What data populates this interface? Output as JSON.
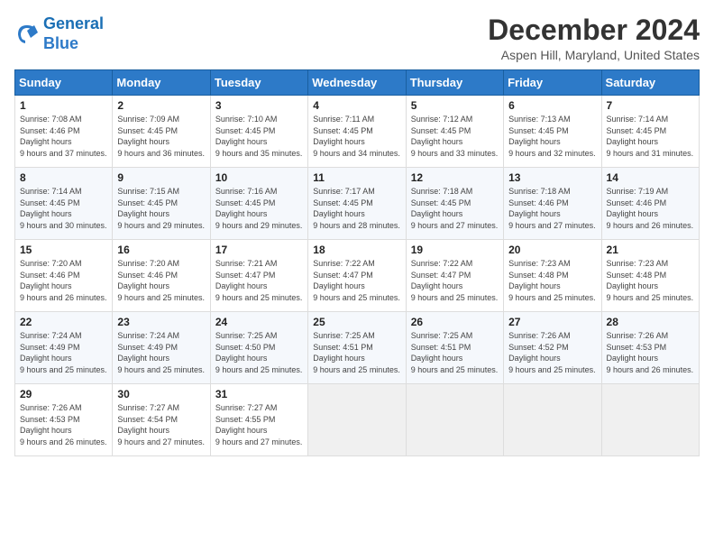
{
  "header": {
    "logo": {
      "line1": "General",
      "line2": "Blue"
    },
    "title": "December 2024",
    "subtitle": "Aspen Hill, Maryland, United States"
  },
  "weekdays": [
    "Sunday",
    "Monday",
    "Tuesday",
    "Wednesday",
    "Thursday",
    "Friday",
    "Saturday"
  ],
  "weeks": [
    [
      {
        "day": "1",
        "sunrise": "7:08 AM",
        "sunset": "4:46 PM",
        "daylight": "9 hours and 37 minutes."
      },
      {
        "day": "2",
        "sunrise": "7:09 AM",
        "sunset": "4:45 PM",
        "daylight": "9 hours and 36 minutes."
      },
      {
        "day": "3",
        "sunrise": "7:10 AM",
        "sunset": "4:45 PM",
        "daylight": "9 hours and 35 minutes."
      },
      {
        "day": "4",
        "sunrise": "7:11 AM",
        "sunset": "4:45 PM",
        "daylight": "9 hours and 34 minutes."
      },
      {
        "day": "5",
        "sunrise": "7:12 AM",
        "sunset": "4:45 PM",
        "daylight": "9 hours and 33 minutes."
      },
      {
        "day": "6",
        "sunrise": "7:13 AM",
        "sunset": "4:45 PM",
        "daylight": "9 hours and 32 minutes."
      },
      {
        "day": "7",
        "sunrise": "7:14 AM",
        "sunset": "4:45 PM",
        "daylight": "9 hours and 31 minutes."
      }
    ],
    [
      {
        "day": "8",
        "sunrise": "7:14 AM",
        "sunset": "4:45 PM",
        "daylight": "9 hours and 30 minutes."
      },
      {
        "day": "9",
        "sunrise": "7:15 AM",
        "sunset": "4:45 PM",
        "daylight": "9 hours and 29 minutes."
      },
      {
        "day": "10",
        "sunrise": "7:16 AM",
        "sunset": "4:45 PM",
        "daylight": "9 hours and 29 minutes."
      },
      {
        "day": "11",
        "sunrise": "7:17 AM",
        "sunset": "4:45 PM",
        "daylight": "9 hours and 28 minutes."
      },
      {
        "day": "12",
        "sunrise": "7:18 AM",
        "sunset": "4:45 PM",
        "daylight": "9 hours and 27 minutes."
      },
      {
        "day": "13",
        "sunrise": "7:18 AM",
        "sunset": "4:46 PM",
        "daylight": "9 hours and 27 minutes."
      },
      {
        "day": "14",
        "sunrise": "7:19 AM",
        "sunset": "4:46 PM",
        "daylight": "9 hours and 26 minutes."
      }
    ],
    [
      {
        "day": "15",
        "sunrise": "7:20 AM",
        "sunset": "4:46 PM",
        "daylight": "9 hours and 26 minutes."
      },
      {
        "day": "16",
        "sunrise": "7:20 AM",
        "sunset": "4:46 PM",
        "daylight": "9 hours and 25 minutes."
      },
      {
        "day": "17",
        "sunrise": "7:21 AM",
        "sunset": "4:47 PM",
        "daylight": "9 hours and 25 minutes."
      },
      {
        "day": "18",
        "sunrise": "7:22 AM",
        "sunset": "4:47 PM",
        "daylight": "9 hours and 25 minutes."
      },
      {
        "day": "19",
        "sunrise": "7:22 AM",
        "sunset": "4:47 PM",
        "daylight": "9 hours and 25 minutes."
      },
      {
        "day": "20",
        "sunrise": "7:23 AM",
        "sunset": "4:48 PM",
        "daylight": "9 hours and 25 minutes."
      },
      {
        "day": "21",
        "sunrise": "7:23 AM",
        "sunset": "4:48 PM",
        "daylight": "9 hours and 25 minutes."
      }
    ],
    [
      {
        "day": "22",
        "sunrise": "7:24 AM",
        "sunset": "4:49 PM",
        "daylight": "9 hours and 25 minutes."
      },
      {
        "day": "23",
        "sunrise": "7:24 AM",
        "sunset": "4:49 PM",
        "daylight": "9 hours and 25 minutes."
      },
      {
        "day": "24",
        "sunrise": "7:25 AM",
        "sunset": "4:50 PM",
        "daylight": "9 hours and 25 minutes."
      },
      {
        "day": "25",
        "sunrise": "7:25 AM",
        "sunset": "4:51 PM",
        "daylight": "9 hours and 25 minutes."
      },
      {
        "day": "26",
        "sunrise": "7:25 AM",
        "sunset": "4:51 PM",
        "daylight": "9 hours and 25 minutes."
      },
      {
        "day": "27",
        "sunrise": "7:26 AM",
        "sunset": "4:52 PM",
        "daylight": "9 hours and 25 minutes."
      },
      {
        "day": "28",
        "sunrise": "7:26 AM",
        "sunset": "4:53 PM",
        "daylight": "9 hours and 26 minutes."
      }
    ],
    [
      {
        "day": "29",
        "sunrise": "7:26 AM",
        "sunset": "4:53 PM",
        "daylight": "9 hours and 26 minutes."
      },
      {
        "day": "30",
        "sunrise": "7:27 AM",
        "sunset": "4:54 PM",
        "daylight": "9 hours and 27 minutes."
      },
      {
        "day": "31",
        "sunrise": "7:27 AM",
        "sunset": "4:55 PM",
        "daylight": "9 hours and 27 minutes."
      },
      null,
      null,
      null,
      null
    ]
  ]
}
